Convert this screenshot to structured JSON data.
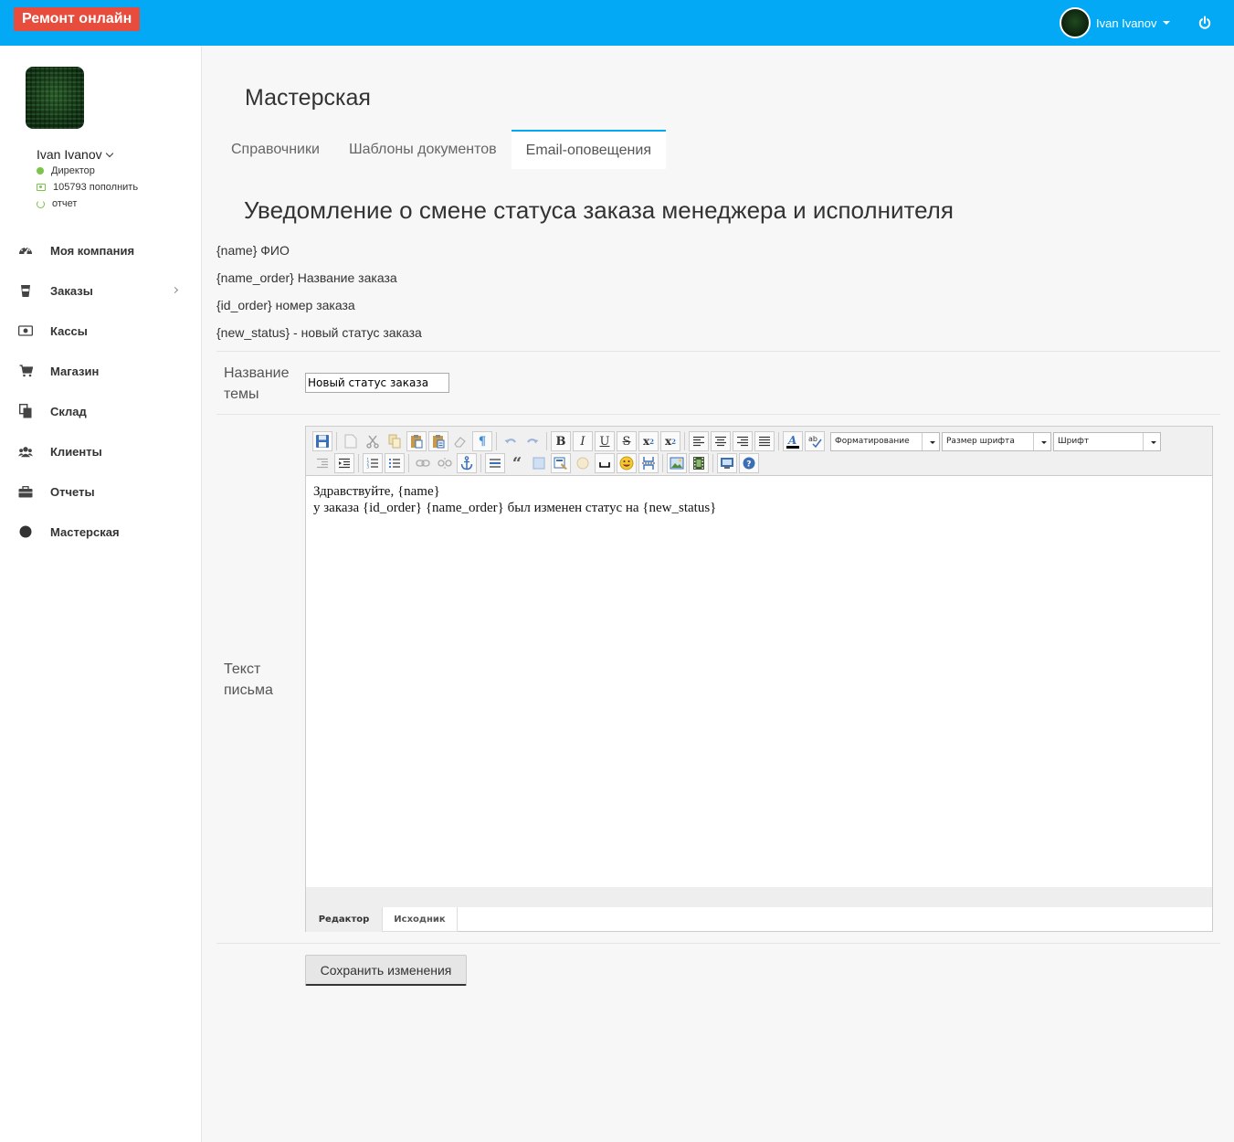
{
  "header": {
    "brand": "Ремонт онлайн",
    "user_name": "Ivan Ivanov",
    "icons": [
      "avatar",
      "caret-down-icon",
      "power-icon"
    ]
  },
  "sidebar": {
    "user_name": "Ivan Ivanov",
    "role": "Директор",
    "balance": "105793 пополнить",
    "report": "отчет",
    "items": [
      {
        "label": "Моя компания",
        "icon": "dashboard-icon"
      },
      {
        "label": "Заказы",
        "icon": "cup-icon",
        "has_submenu": true
      },
      {
        "label": "Кассы",
        "icon": "money-icon"
      },
      {
        "label": "Магазин",
        "icon": "cart-icon"
      },
      {
        "label": "Склад",
        "icon": "copy-icon"
      },
      {
        "label": "Клиенты",
        "icon": "users-icon"
      },
      {
        "label": "Отчеты",
        "icon": "briefcase-icon"
      },
      {
        "label": "Мастерская",
        "icon": "circle-icon"
      }
    ]
  },
  "main": {
    "title": "Мастерская",
    "tabs": [
      {
        "label": "Справочники",
        "active": false
      },
      {
        "label": "Шаблоны документов",
        "active": false
      },
      {
        "label": "Email-оповещения",
        "active": true
      }
    ],
    "section_title": "Уведомление о смене статуса заказа менеджера и исполнителя",
    "variables": [
      "{name} ФИО",
      "{name_order} Название заказа",
      "{id_order} номер заказа",
      "{new_status} - новый статус заказа"
    ],
    "subject_label": "Название темы",
    "subject_value": "Новый статус заказа",
    "body_label": "Текст письма",
    "editor": {
      "format_select": "Форматирование",
      "size_select": "Размер шрифта",
      "font_select": "Шрифт",
      "content_line1": "Здравствуйте, {name}",
      "content_line2": "у заказа {id_order} {name_order} был изменен статус на {new_status}",
      "mode_editor": "Редактор",
      "mode_source": "Исходник"
    },
    "save_label": "Сохранить изменения"
  },
  "colors": {
    "topbar": "#03a9f4",
    "brand": "#e74c3c",
    "status_green": "#7cc34b"
  }
}
